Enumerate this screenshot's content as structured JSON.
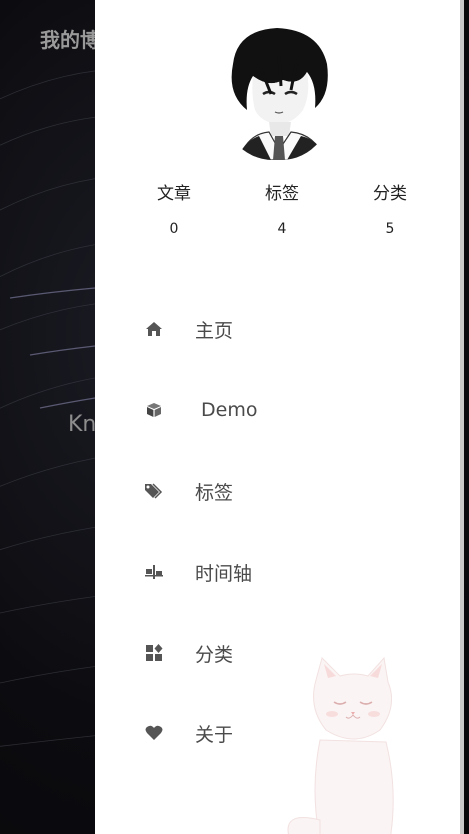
{
  "background": {
    "title": "我的博",
    "subtitle": "Kn"
  },
  "profile": {
    "stats": [
      {
        "label": "文章",
        "value": "0"
      },
      {
        "label": "标签",
        "value": "4"
      },
      {
        "label": "分类",
        "value": "5"
      }
    ]
  },
  "menu": {
    "items": [
      {
        "label": "主页",
        "icon": "home-icon"
      },
      {
        "label": "Demo",
        "icon": "cube-icon"
      },
      {
        "label": "标签",
        "icon": "tags-icon"
      },
      {
        "label": "时间轴",
        "icon": "timeline-icon"
      },
      {
        "label": "分类",
        "icon": "category-icon"
      },
      {
        "label": "关于",
        "icon": "heart-icon"
      }
    ]
  },
  "colors": {
    "drawer_bg": "#ffffff",
    "icon": "#555555",
    "text": "#4a4a4a",
    "page_bg": "#0d0d12"
  }
}
